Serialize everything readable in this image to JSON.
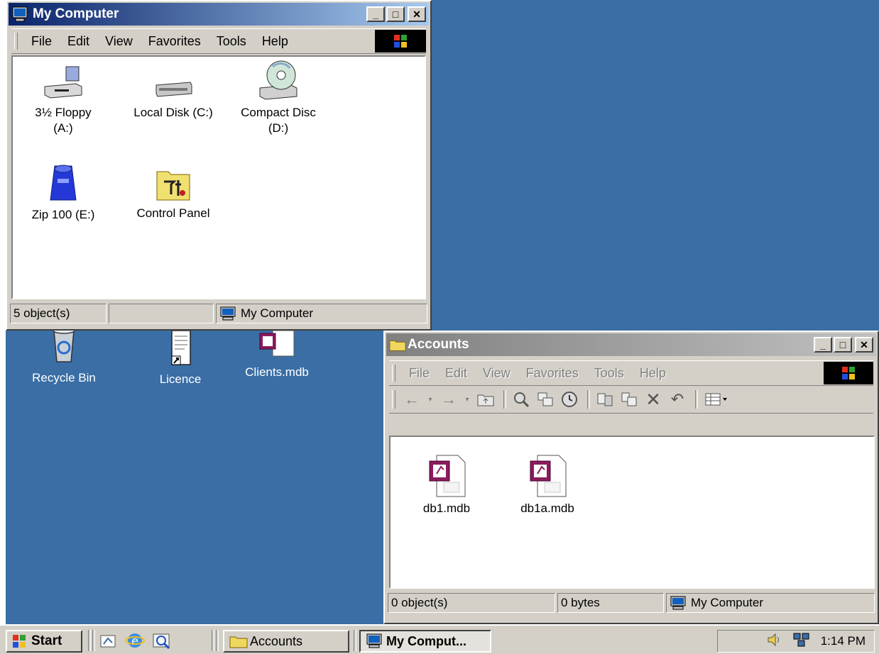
{
  "desktop": {
    "icons": [
      {
        "label": "Recycle Bin",
        "icon": "recycle-bin-icon"
      },
      {
        "label": "Licence",
        "icon": "document-shortcut-icon"
      },
      {
        "label": "Clients.mdb",
        "icon": "access-database-icon"
      }
    ]
  },
  "my_computer": {
    "title": "My Computer",
    "menu": [
      "File",
      "Edit",
      "View",
      "Favorites",
      "Tools",
      "Help"
    ],
    "items": [
      {
        "label_line1": "3½ Floppy",
        "label_line2": "(A:)",
        "icon": "floppy-drive-icon"
      },
      {
        "label_line1": "Local Disk (C:)",
        "label_line2": "",
        "icon": "hard-disk-icon"
      },
      {
        "label_line1": "Compact Disc",
        "label_line2": "(D:)",
        "icon": "cd-drive-icon"
      },
      {
        "label_line1": "Zip 100 (E:)",
        "label_line2": "",
        "icon": "zip-drive-icon"
      },
      {
        "label_line1": "Control Panel",
        "label_line2": "",
        "icon": "control-panel-icon"
      }
    ],
    "status": {
      "count": "5 object(s)",
      "zone": "My Computer"
    }
  },
  "accounts": {
    "title": "Accounts",
    "menu": [
      "File",
      "Edit",
      "View",
      "Favorites",
      "Tools",
      "Help"
    ],
    "files": [
      {
        "label": "db1.mdb",
        "icon": "access-database-icon"
      },
      {
        "label": "db1a.mdb",
        "icon": "access-database-icon"
      }
    ],
    "status": {
      "count": "0 object(s)",
      "size": "0 bytes",
      "zone": "My Computer"
    }
  },
  "taskbar": {
    "start": "Start",
    "tasks": [
      {
        "label": "Accounts",
        "active": false
      },
      {
        "label": "My Comput...",
        "active": true
      }
    ],
    "clock": "1:14 PM"
  }
}
